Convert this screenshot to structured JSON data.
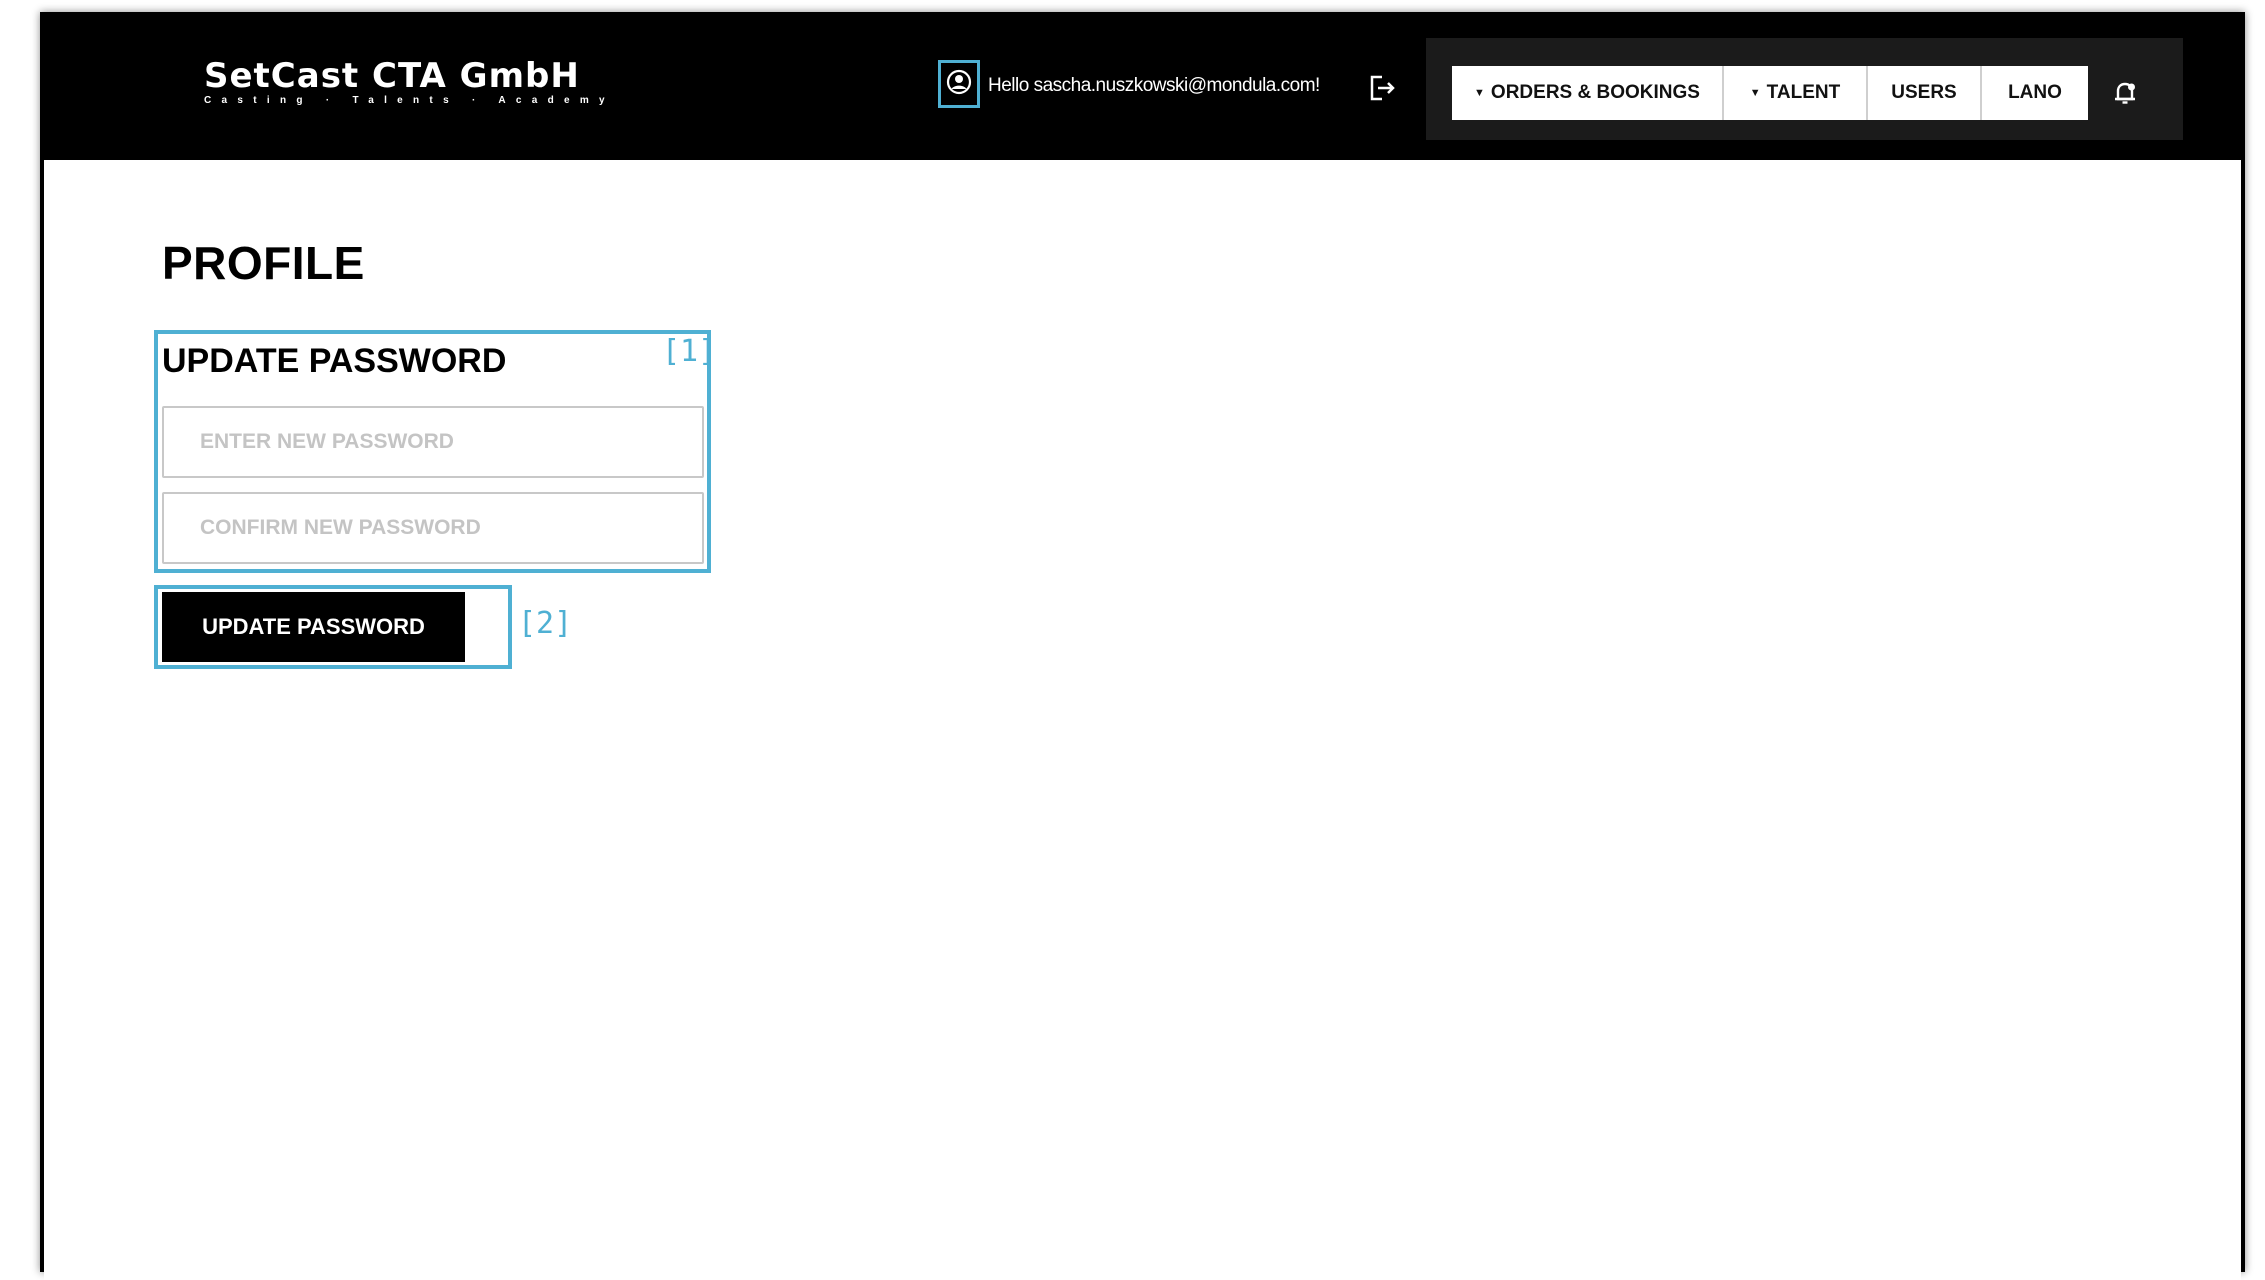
{
  "brand": {
    "name": "SetCast CTA GmbH",
    "tagline": "Casting · Talents · Academy"
  },
  "header": {
    "greeting": "Hello sascha.nuszkowski@mondula.com!",
    "nav": [
      {
        "label": "ORDERS & BOOKINGS",
        "dropdown": true
      },
      {
        "label": "TALENT",
        "dropdown": true
      },
      {
        "label": "USERS",
        "dropdown": false
      },
      {
        "label": "LANO",
        "dropdown": false
      }
    ]
  },
  "page": {
    "title": "PROFILE"
  },
  "password_section": {
    "title": "UPDATE PASSWORD",
    "new_password_placeholder": "ENTER NEW PASSWORD",
    "confirm_password_placeholder": "CONFIRM NEW PASSWORD",
    "new_password_value": "",
    "confirm_password_value": "",
    "submit_label": "UPDATE PASSWORD"
  },
  "markers": {
    "section": "[1]",
    "button": "[2]"
  },
  "colors": {
    "highlight": "#4fb0d3",
    "header_bg": "#000000",
    "nav_panel_bg": "#1b1b1b",
    "button_bg": "#000000"
  },
  "icons": {
    "user": "user-circle-icon",
    "logout": "logout-icon",
    "notifications": "bell-icon"
  }
}
